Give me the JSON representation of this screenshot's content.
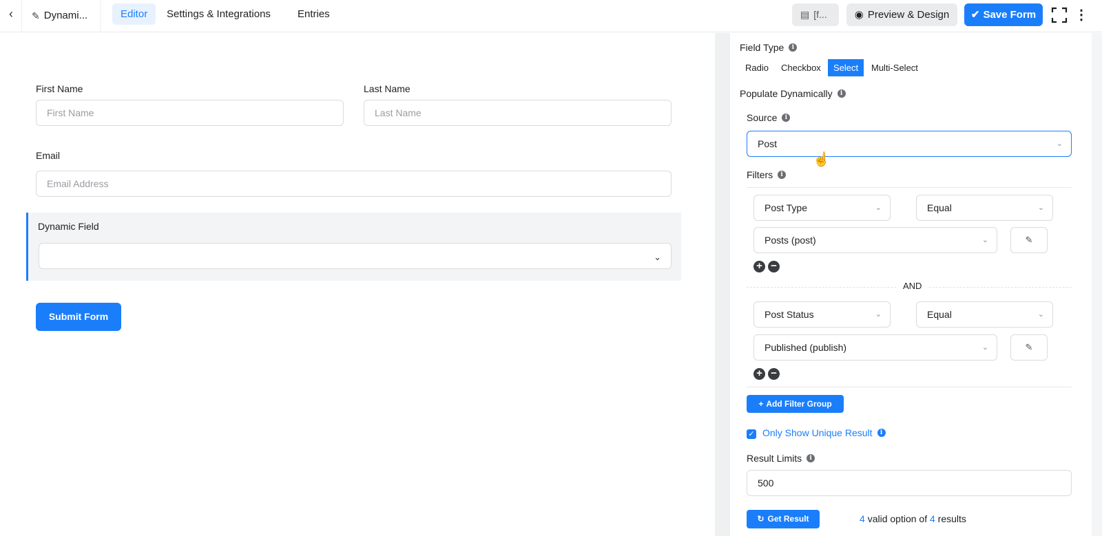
{
  "topbar": {
    "back_icon": "chevron-left-icon",
    "form_name": "Dynami...",
    "tabs": [
      {
        "label": "Editor",
        "active": true
      },
      {
        "label": "Settings & Integrations",
        "active": false
      },
      {
        "label": "Entries",
        "active": false
      }
    ],
    "shortcode_label": "[f...",
    "preview_label": "Preview & Design",
    "save_label": "Save Form"
  },
  "form": {
    "first_name": {
      "label": "First Name",
      "placeholder": "First Name"
    },
    "last_name": {
      "label": "Last Name",
      "placeholder": "Last Name"
    },
    "email": {
      "label": "Email",
      "placeholder": "Email Address"
    },
    "dynamic_field": {
      "label": "Dynamic Field",
      "value": ""
    },
    "submit_label": "Submit Form"
  },
  "panel": {
    "field_type_label": "Field Type",
    "field_types": [
      {
        "label": "Radio",
        "active": false
      },
      {
        "label": "Checkbox",
        "active": false
      },
      {
        "label": "Select",
        "active": true
      },
      {
        "label": "Multi-Select",
        "active": false
      }
    ],
    "populate_label": "Populate Dynamically",
    "source_label": "Source",
    "source_value": "Post",
    "filters_label": "Filters",
    "filter_groups": [
      {
        "column": "Post Type",
        "operator": "Equal",
        "value": "Posts (post)"
      },
      {
        "column": "Post Status",
        "operator": "Equal",
        "value": "Published (publish)"
      }
    ],
    "and_label": "AND",
    "add_filter_group_label": "Add Filter Group",
    "unique_label": "Only Show Unique Result",
    "unique_checked": true,
    "result_limits_label": "Result Limits",
    "result_limits_value": "500",
    "get_result_label": "Get Result",
    "result_valid": "4",
    "result_mid": "valid option of",
    "result_total": "4",
    "result_end": "results"
  },
  "colors": {
    "accent": "#1a7efb",
    "text": "#1e1f21",
    "muted": "#9a9ca1"
  }
}
